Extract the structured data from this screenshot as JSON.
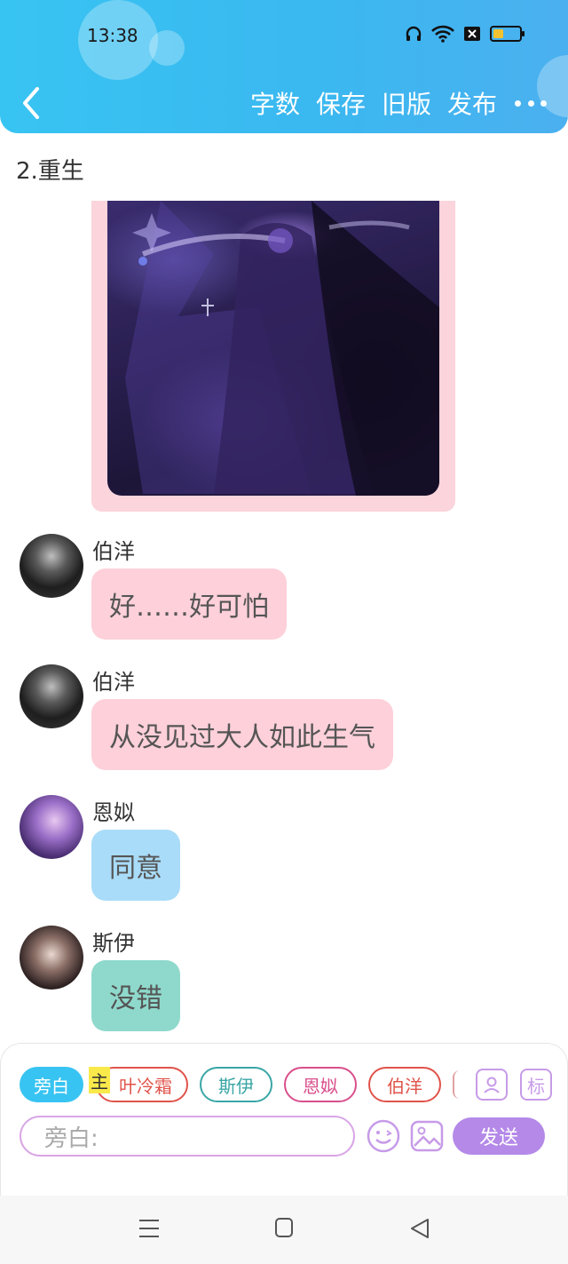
{
  "status_bar": {
    "time": "13:38"
  },
  "toolbar": {
    "word_count_label": "字数",
    "save_label": "保存",
    "old_version_label": "旧版",
    "publish_label": "发布"
  },
  "chapter": {
    "title": "2.重生"
  },
  "messages": [
    {
      "sender": "伯洋",
      "text": "好……好可怕",
      "bubble_color": "#fdd0da"
    },
    {
      "sender": "伯洋",
      "text": "从没见过大人如此生气",
      "bubble_color": "#fdd0da"
    },
    {
      "sender": "恩姒",
      "text": "同意",
      "bubble_color": "#a9dcf8"
    },
    {
      "sender": "斯伊",
      "text": "没错",
      "bubble_color": "#8fd9cc"
    }
  ],
  "characters": {
    "narrator": "旁白",
    "main_badge": "主",
    "items": [
      {
        "name": "叶冷霜",
        "color": "#e0534a"
      },
      {
        "name": "斯伊",
        "color": "#3aa6a6"
      },
      {
        "name": "恩姒",
        "color": "#d94f8c"
      },
      {
        "name": "伯洋",
        "color": "#e0534a"
      }
    ],
    "tag_label": "标"
  },
  "composer": {
    "placeholder": "旁白:",
    "send_label": "发送"
  },
  "colors": {
    "header": "#3ab8f0",
    "accent_purple": "#b489e8",
    "narrator_chip": "#38c4f2"
  }
}
